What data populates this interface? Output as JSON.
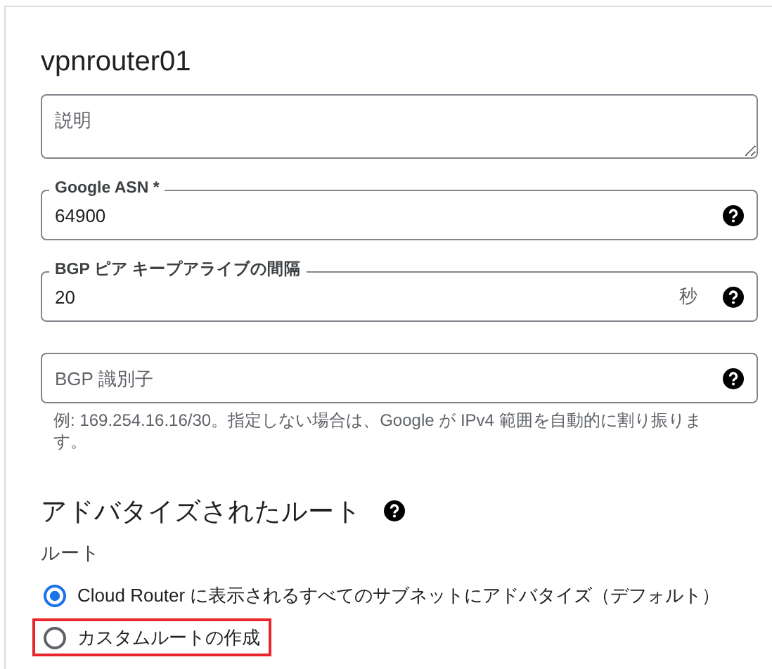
{
  "title": "vpnrouter01",
  "fields": [
    {
      "kind": "textarea",
      "placeholder": "説明"
    },
    {
      "kind": "outlined",
      "label": "Google ASN *",
      "value": "64900",
      "help_icon": true
    },
    {
      "kind": "outlined",
      "label": "BGP ピア キープアライブの間隔",
      "value": "20",
      "suffix": "秒",
      "help_icon": true
    },
    {
      "kind": "plain",
      "placeholder": "BGP 識別子",
      "help_icon": true,
      "hint": "例: 169.254.16.16/30。指定しない場合は、Google が IPv4 範囲を自動的に割り振ります。"
    }
  ],
  "section": {
    "title": "アドバタイズされたルート",
    "help_icon": true
  },
  "route_label": "ルート",
  "options": [
    {
      "label": "Cloud Router に表示されるすべてのサブネットにアドバタイズ（デフォルト）",
      "selected": true,
      "highlighted": false
    },
    {
      "label": "カスタムルートの作成",
      "selected": false,
      "highlighted": true
    }
  ]
}
